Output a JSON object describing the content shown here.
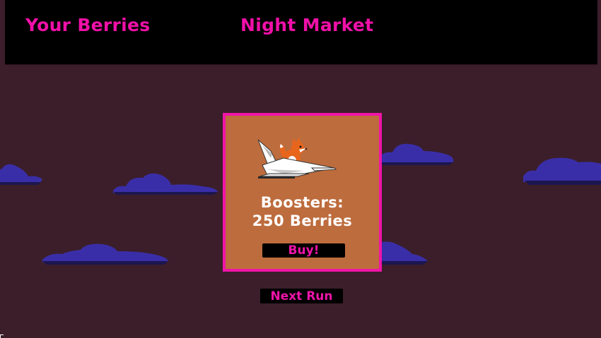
{
  "header": {
    "berries_label": "Your Berries",
    "shop_title": "Night Market"
  },
  "shop": {
    "item_name": "Boosters:",
    "item_price": "250 Berries",
    "item_icon": "fox-on-paper-plane-icon",
    "buy_label": "Buy!"
  },
  "footer": {
    "next_run_label": "Next Run"
  },
  "colors": {
    "accent": "#f014a8",
    "background": "#3b1e2a",
    "card": "#bd6c3d",
    "cloud": "#3a2ea8",
    "bar": "#000000"
  }
}
